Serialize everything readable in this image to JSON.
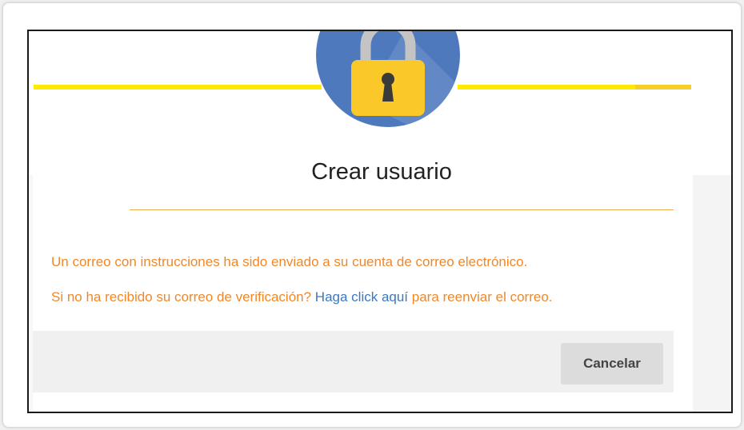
{
  "dialog": {
    "title": "Crear usuario",
    "message_sent": "Un correo con instrucciones ha sido enviado a su cuenta de correo electrónico.",
    "resend_prefix": "Si no ha recibido su correo de verificación? ",
    "resend_link_1": "Haga click aquí",
    "resend_suffix": " para reenviar el correo.",
    "cancel_label": "Cancelar"
  },
  "icons": {
    "header": "padlock-icon"
  },
  "colors": {
    "accent_yellow": "#ffea00",
    "circle_blue": "#4f79bd",
    "message_orange": "#f0882a",
    "link_blue": "#3a78c3",
    "divider_orange": "#f0ad4e"
  }
}
